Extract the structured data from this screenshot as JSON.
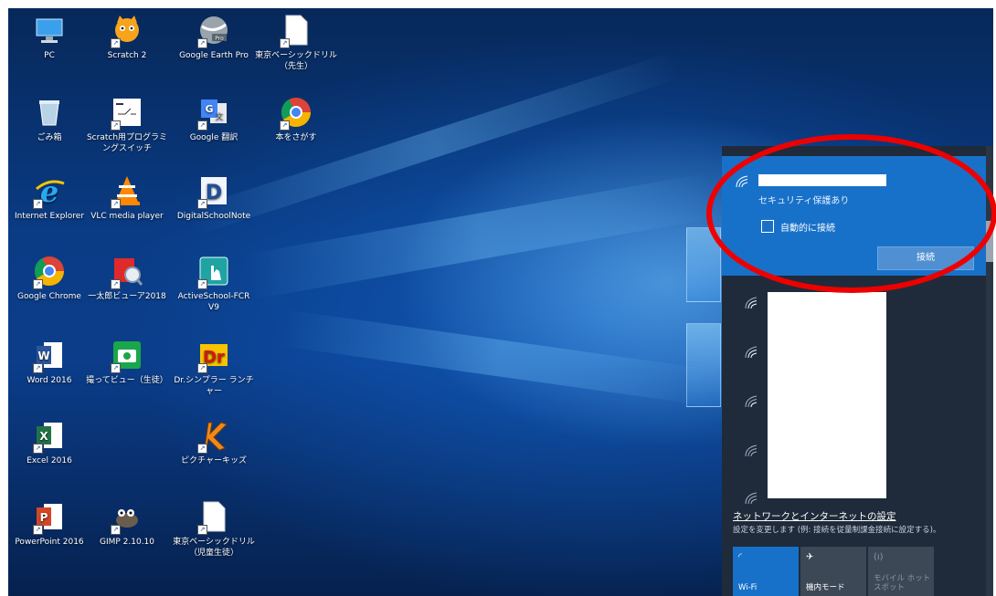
{
  "desktop": {
    "icons": [
      {
        "id": "pc",
        "label": "PC",
        "icon": "pc-icon",
        "shortcut": false
      },
      {
        "id": "scratch2",
        "label": "Scratch 2",
        "icon": "scratch-cat-icon",
        "shortcut": true
      },
      {
        "id": "google-earth",
        "label": "Google Earth Pro",
        "icon": "google-earth-icon",
        "shortcut": true
      },
      {
        "id": "tokyo-basic-teacher",
        "label": "東京ベーシックドリル（先生）",
        "icon": "document-icon",
        "shortcut": true
      },
      {
        "id": "recycle",
        "label": "ごみ箱",
        "icon": "recycle-bin-icon",
        "shortcut": false
      },
      {
        "id": "scratch-switch",
        "label": "Scratch用プログラミングスイッチ",
        "icon": "switch-icon",
        "shortcut": true
      },
      {
        "id": "google-translate",
        "label": "Google 翻訳",
        "icon": "google-translate-icon",
        "shortcut": true
      },
      {
        "id": "book-search",
        "label": "本をさがす",
        "icon": "chrome-icon",
        "shortcut": true
      },
      {
        "id": "ie",
        "label": "Internet Explorer",
        "icon": "internet-explorer-icon",
        "shortcut": true
      },
      {
        "id": "vlc",
        "label": "VLC media player",
        "icon": "vlc-icon",
        "shortcut": true
      },
      {
        "id": "digitalschoolnote",
        "label": "DigitalSchoolNote",
        "icon": "digitalschoolnote-icon",
        "shortcut": true
      },
      {
        "id": "chrome",
        "label": "Google Chrome",
        "icon": "chrome-icon",
        "shortcut": true
      },
      {
        "id": "ichitaro",
        "label": "一太郎ビューア2018",
        "icon": "ichitaro-viewer-icon",
        "shortcut": true
      },
      {
        "id": "activeschool",
        "label": "ActiveSchool-FCR V9",
        "icon": "activeschool-icon",
        "shortcut": true
      },
      {
        "id": "word",
        "label": "Word 2016",
        "icon": "word-icon",
        "shortcut": true
      },
      {
        "id": "totte-view",
        "label": "撮ってビュー（生徒）",
        "icon": "camera-icon",
        "shortcut": true
      },
      {
        "id": "dr-simpler",
        "label": "Dr.シンプラー ランチャー",
        "icon": "dr-simpler-icon",
        "shortcut": true
      },
      {
        "id": "excel",
        "label": "Excel 2016",
        "icon": "excel-icon",
        "shortcut": true
      },
      {
        "id": "picture-kids",
        "label": "ピクチャーキッズ",
        "icon": "picture-kids-icon",
        "shortcut": true
      },
      {
        "id": "powerpoint",
        "label": "PowerPoint 2016",
        "icon": "powerpoint-icon",
        "shortcut": true
      },
      {
        "id": "gimp",
        "label": "GIMP 2.10.10",
        "icon": "gimp-icon",
        "shortcut": true
      },
      {
        "id": "tokyo-basic-student",
        "label": "東京ベーシックドリル（児童生徒）",
        "icon": "document-icon",
        "shortcut": true
      }
    ]
  },
  "network": {
    "selected": {
      "security": "セキュリティ保護あり",
      "auto_connect_label": "自動的に接続",
      "auto_connect_checked": false,
      "connect_label": "接続"
    },
    "settings_link": "ネットワークとインターネットの設定",
    "settings_desc": "設定を変更します (例: 接続を従量制課金接続に設定する)。",
    "quick_actions": [
      {
        "id": "wifi",
        "label": "Wi-Fi",
        "icon": "wifi-icon",
        "active": true
      },
      {
        "id": "airplane",
        "label": "機内モード",
        "icon": "airplane-icon",
        "active": false
      },
      {
        "id": "hotspot",
        "label": "モバイル ホットスポット",
        "icon": "hotspot-icon",
        "active": false,
        "disabled": true
      }
    ]
  },
  "colors": {
    "accent": "#1871c9",
    "flyout_bg": "#1f2b3a",
    "annotation": "#ee0000"
  }
}
